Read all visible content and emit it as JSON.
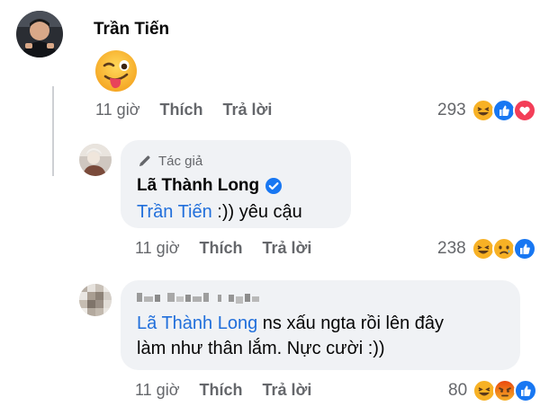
{
  "comments": [
    {
      "author": "Trần Tiến",
      "emoji_body": "winking-tongue-emoji",
      "time": "11 giờ",
      "like_label": "Thích",
      "reply_label": "Trả lời",
      "reaction_count": "293",
      "reactions": [
        "haha",
        "like",
        "love"
      ]
    },
    {
      "author_badge": "Tác giả",
      "author": "Lã Thành Long",
      "verified": true,
      "mention": "Trần Tiến",
      "text": " :)) yêu cậu",
      "time": "11 giờ",
      "like_label": "Thích",
      "reply_label": "Trả lời",
      "reaction_count": "238",
      "reactions": [
        "haha",
        "sad",
        "like"
      ]
    },
    {
      "author_blurred": true,
      "mention": "Lã Thành Long",
      "text_line1": " ns xấu ngta rồi lên đây",
      "text_line2": "làm như thân lắm. Nực cười :))",
      "time": "11 giờ",
      "like_label": "Thích",
      "reply_label": "Trả lời",
      "reaction_count": "80",
      "reactions": [
        "haha",
        "angry",
        "like"
      ]
    }
  ],
  "colors": {
    "mention": "#216fdb",
    "bubble": "#f0f2f5",
    "meta": "#65676b",
    "like_blue": "#1877f2",
    "love_red": "#f33e58",
    "emoji_yellow": "#f7b125"
  }
}
